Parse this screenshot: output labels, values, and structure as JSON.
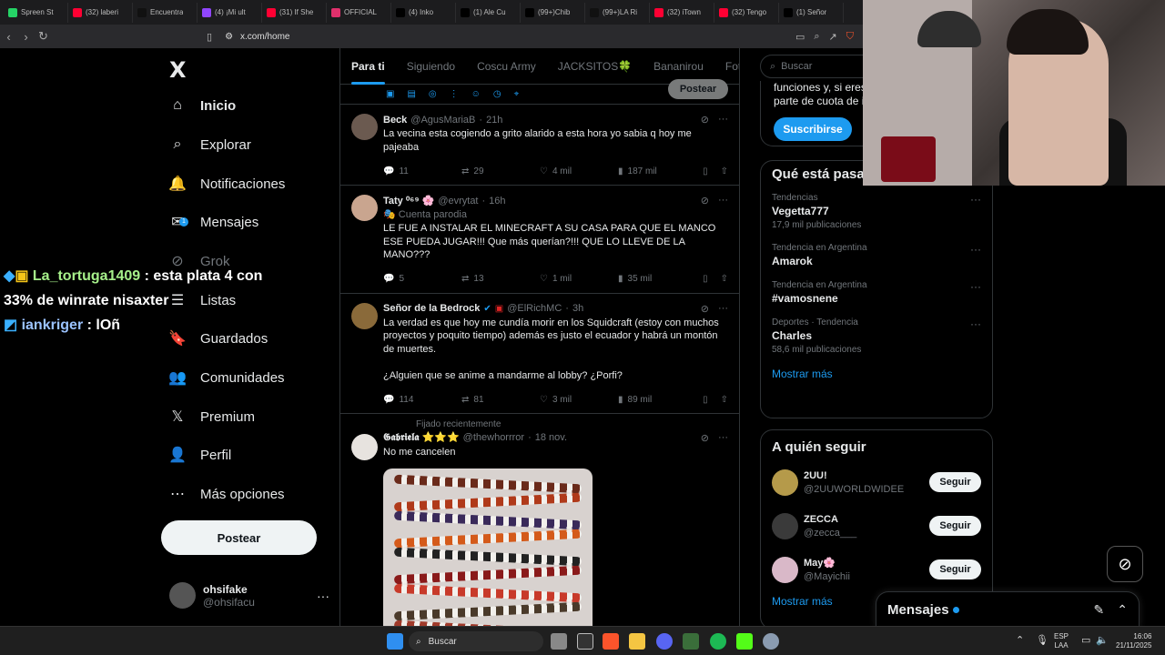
{
  "browser": {
    "tabs": [
      {
        "label": "Spreen St",
        "color": "#25d366"
      },
      {
        "label": "(32) laberi",
        "color": "#ff0033"
      },
      {
        "label": "Encuentra",
        "color": "#111111"
      },
      {
        "label": "(4) ¡Mi ult",
        "color": "#9146ff"
      },
      {
        "label": "(31) If She",
        "color": "#ff0033"
      },
      {
        "label": "OFFICIAL",
        "color": "#e1306c"
      },
      {
        "label": "(4) Inko",
        "color": "#000000"
      },
      {
        "label": "(1) Ale Cu",
        "color": "#000000"
      },
      {
        "label": "(99+)Chib",
        "color": "#000000"
      },
      {
        "label": "(99+)LA Ri",
        "color": "#111111"
      },
      {
        "label": "(32) iTown",
        "color": "#ff0033"
      },
      {
        "label": "(32) Tengo",
        "color": "#ff0033"
      },
      {
        "label": "(1) Señor",
        "color": "#000000"
      }
    ],
    "url": "x.com/home"
  },
  "sidebar": {
    "logo": "X",
    "items": [
      {
        "label": "Inicio",
        "icon": "home-icon",
        "glyph": "⌂",
        "active": true
      },
      {
        "label": "Explorar",
        "icon": "search-icon",
        "glyph": "⌕"
      },
      {
        "label": "Notificaciones",
        "icon": "bell-icon",
        "glyph": "🔔"
      },
      {
        "label": "Mensajes",
        "icon": "envelope-icon",
        "glyph": "✉",
        "badge": "1"
      },
      {
        "label": "Grok",
        "icon": "grok-icon",
        "glyph": "⊘"
      },
      {
        "label": "Listas",
        "icon": "list-icon",
        "glyph": "☰"
      },
      {
        "label": "Guardados",
        "icon": "bookmark-icon",
        "glyph": "🔖"
      },
      {
        "label": "Comunidades",
        "icon": "communities-icon",
        "glyph": "👥"
      },
      {
        "label": "Premium",
        "icon": "premium-x-icon",
        "glyph": "𝕏"
      },
      {
        "label": "Perfil",
        "icon": "person-icon",
        "glyph": "👤"
      },
      {
        "label": "Más opciones",
        "icon": "more-circle-icon",
        "glyph": "⋯"
      }
    ],
    "post_label": "Postear",
    "profile": {
      "name": "ohsifake",
      "handle": "@ohsifacu",
      "more": "···"
    }
  },
  "chat": [
    {
      "user": "La_tortuga1409",
      "text": ": esta plata 4 con 33% de winrate nisaxter"
    },
    {
      "user": "iankriger",
      "text": ": lOñ"
    }
  ],
  "feed": {
    "tabs": [
      "Para ti",
      "Siguiendo",
      "Coscu Army",
      "JACKSITOS🍀",
      "Bananirou",
      "Fotos d"
    ],
    "composer_post": "Postear",
    "tweets": [
      {
        "name": "Beck",
        "handle": "@AgusMariaB",
        "time": "21h",
        "text": "La vecina esta cogiendo a grito alarido a esta hora yo sabia q hoy me pajeaba",
        "replies": "11",
        "reposts": "29",
        "likes": "4 mil",
        "views": "187 mil",
        "avatar_color": "#6b5a50"
      },
      {
        "name": "Taty ⁰⁶⁹ 🌸",
        "handle": "@evrytat",
        "time": "16h",
        "parody": "🎭 Cuenta parodia",
        "text": "LE FUE A INSTALAR EL MINECRAFT A SU CASA PARA QUE EL MANCO ESE PUEDA JUGAR!!! Que más querían?!!! QUE LO LLEVE DE LA MANO???",
        "replies": "5",
        "reposts": "13",
        "likes": "1 mil",
        "views": "35 mil",
        "avatar_color": "#c9a58f"
      },
      {
        "name": "Señor de la Bedrock",
        "handle": "@ElRichMC",
        "time": "3h",
        "text": "La verdad es que hoy me cundía morir en los Squidcraft (estoy con muchos proyectos y poquito tiempo) además es justo el ecuador y habrá un montón de muertes.\n\n¿Alguien que se anime a mandarme al lobby? ¿Porfi?",
        "replies": "114",
        "reposts": "81",
        "likes": "3 mil",
        "views": "89 mil",
        "avatar_color": "#8a6a3a"
      },
      {
        "pinned": "Fijado recientemente",
        "name": "𝕲𝖆𝖇𝖗𝖎𝖊𝖑𝖆 ⭐⭐⭐",
        "handle": "@thewhorrror",
        "time": "18 nov.",
        "text": "No me cancelen",
        "avatar_color": "#e7e3df"
      }
    ]
  },
  "right": {
    "search_placeholder": "Buscar",
    "premium_text": "funciones y, si eres elegible, recibir una parte de cuota de ingresos",
    "subscribe_label": "Suscribirse",
    "trends_title": "Qué está pasando",
    "trends": [
      {
        "context": "Tendencias",
        "name": "Vegetta777",
        "count": "17,9 mil publicaciones"
      },
      {
        "context": "Tendencia en Argentina",
        "name": "Amarok",
        "count": ""
      },
      {
        "context": "Tendencia en Argentina",
        "name": "#vamosnene",
        "count": ""
      },
      {
        "context": "Deportes · Tendencia",
        "name": "Charles",
        "count": "58,6 mil publicaciones"
      }
    ],
    "show_more": "Mostrar más",
    "follow_title": "A quién seguir",
    "follow": [
      {
        "name": "2UU!",
        "handle": "@2UUWORLDWIDEE",
        "color": "#b59a4a"
      },
      {
        "name": "ZECCA",
        "handle": "@zecca___",
        "color": "#3a3a3a"
      },
      {
        "name": "May🌸",
        "handle": "@Mayichii",
        "color": "#d9b8c8"
      }
    ],
    "follow_label": "Seguir",
    "follow_more": "Mostrar más"
  },
  "messages_drawer": {
    "title": "Mensajes"
  },
  "taskbar": {
    "search": "Buscar",
    "lang": "ESP",
    "lang2": "LAA",
    "time": "16:06",
    "date": "21/11/2025"
  }
}
